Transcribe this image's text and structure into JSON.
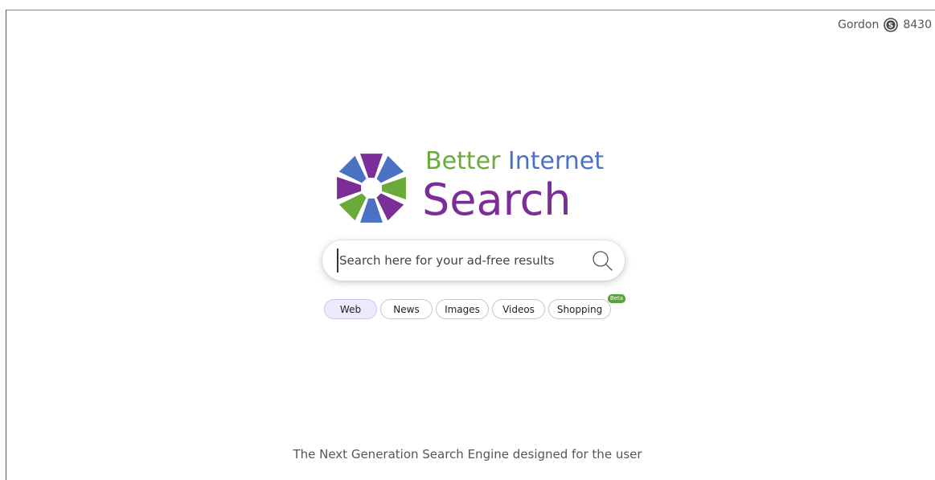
{
  "user": {
    "name": "Gordon",
    "points": "8430",
    "icon": "coin-s-icon"
  },
  "logo": {
    "line1_a": "Better",
    "line1_b": "Internet",
    "line2": "Search",
    "colors": {
      "green": "#6aaa3a",
      "blue": "#4a72c4",
      "purple": "#7b2d98"
    }
  },
  "search": {
    "placeholder": "Search here for your ad-free results",
    "value": "",
    "button_icon": "search-icon"
  },
  "tabs": [
    {
      "label": "Web",
      "active": true
    },
    {
      "label": "News",
      "active": false
    },
    {
      "label": "Images",
      "active": false
    },
    {
      "label": "Videos",
      "active": false
    },
    {
      "label": "Shopping",
      "active": false,
      "badge": "Beta"
    }
  ],
  "tagline": "The Next Generation Search Engine designed for the user"
}
